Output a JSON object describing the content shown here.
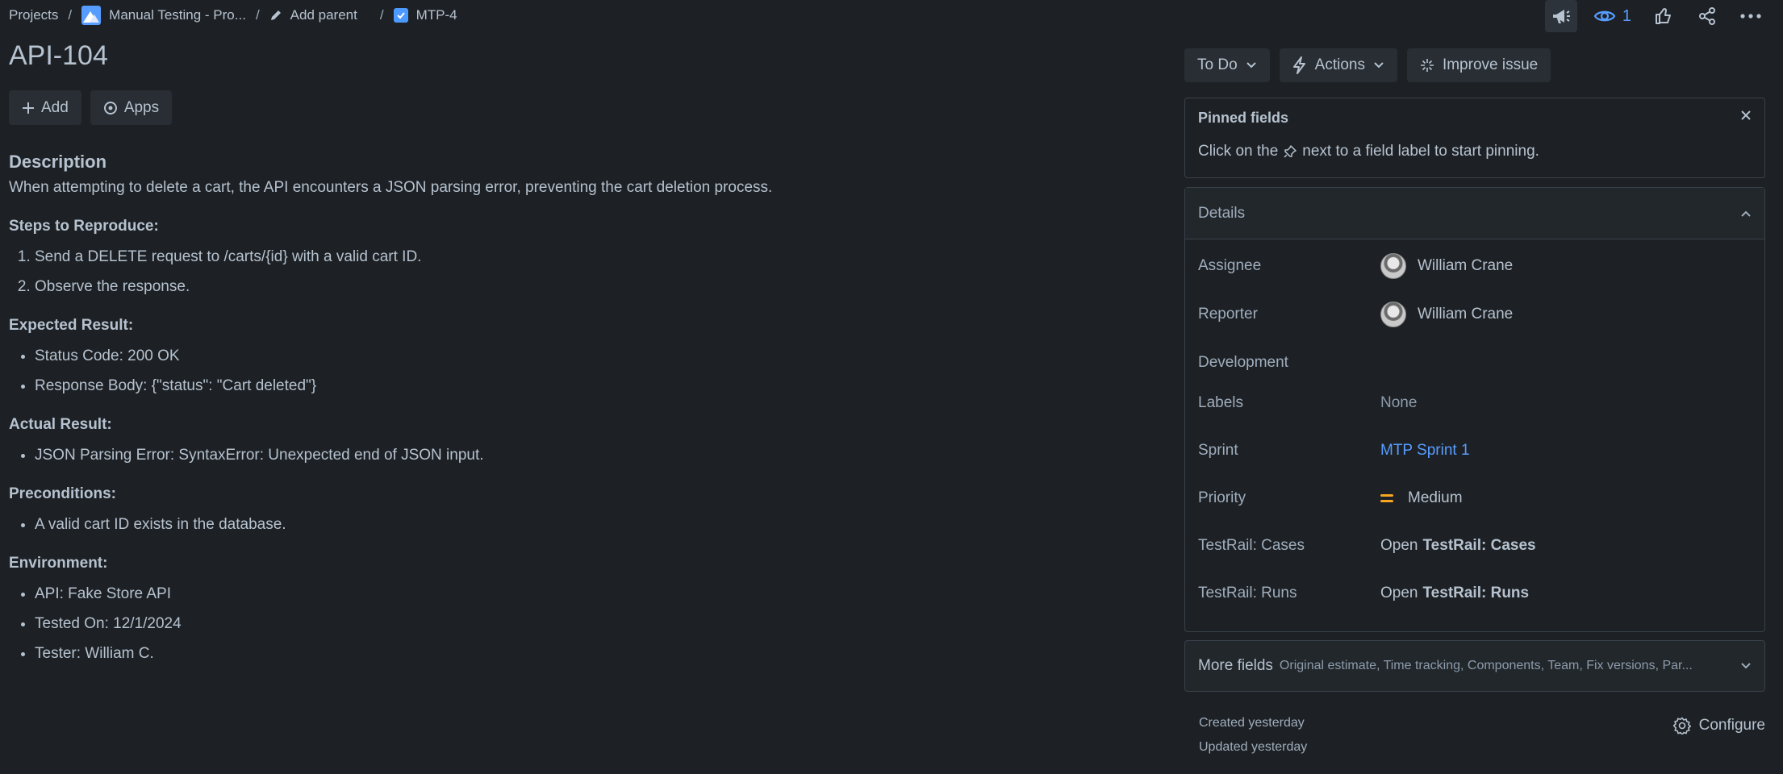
{
  "breadcrumb": {
    "projects": "Projects",
    "sep": "/",
    "project_name": "Manual Testing - Pro...",
    "add_parent": "Add parent",
    "parent_key": "MTP-4"
  },
  "top_icons": {
    "watchers_count": "1"
  },
  "issue": {
    "key": "API-104"
  },
  "left_actions": {
    "add": "Add",
    "apps": "Apps"
  },
  "description": {
    "heading": "Description",
    "summary": "When attempting to delete a cart, the API encounters a JSON parsing error, preventing the cart deletion process.",
    "steps_heading": "Steps to Reproduce:",
    "steps": [
      "Send a DELETE request to /carts/{id} with a valid cart ID.",
      "Observe the response."
    ],
    "expected_heading": "Expected Result:",
    "expected": [
      "Status Code: 200 OK",
      "Response Body: {\"status\": \"Cart deleted\"}"
    ],
    "actual_heading": "Actual Result:",
    "actual": [
      "JSON Parsing Error: SyntaxError: Unexpected end of JSON input."
    ],
    "preconditions_heading": "Preconditions:",
    "preconditions": [
      "A valid cart ID exists in the database."
    ],
    "environment_heading": "Environment:",
    "environment": [
      "API: Fake Store API",
      "Tested On: 12/1/2024",
      "Tester: William C."
    ]
  },
  "status": {
    "status_label": "To Do",
    "actions_label": "Actions",
    "improve_label": "Improve issue"
  },
  "pinned": {
    "title": "Pinned fields",
    "text_before": "Click on the",
    "text_after": "next to a field label to start pinning."
  },
  "details": {
    "title": "Details",
    "fields": {
      "assignee": {
        "label": "Assignee",
        "value": "William Crane"
      },
      "reporter": {
        "label": "Reporter",
        "value": "William Crane"
      },
      "development": {
        "label": "Development",
        "value": ""
      },
      "labels": {
        "label": "Labels",
        "value": "None"
      },
      "sprint": {
        "label": "Sprint",
        "value": "MTP Sprint 1"
      },
      "priority": {
        "label": "Priority",
        "value": "Medium"
      },
      "testrail_cases": {
        "label": "TestRail: Cases",
        "prefix": "Open",
        "value": "TestRail: Cases"
      },
      "testrail_runs": {
        "label": "TestRail: Runs",
        "prefix": "Open",
        "value": "TestRail: Runs"
      }
    }
  },
  "more_fields": {
    "title": "More fields",
    "subtitle": "Original estimate, Time tracking, Components, Team, Fix versions, Par..."
  },
  "meta": {
    "created": "Created yesterday",
    "updated": "Updated yesterday"
  },
  "configure_label": "Configure",
  "colors": {
    "background": "#1d2125",
    "text": "#b6c2cf",
    "link": "#579dff",
    "priority_medium": "#f5a623"
  }
}
